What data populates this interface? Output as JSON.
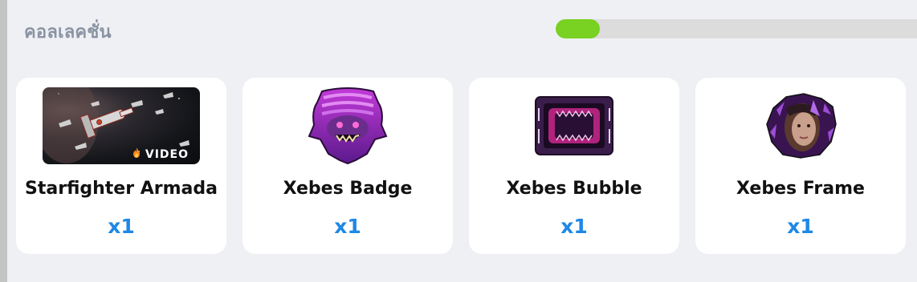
{
  "section": {
    "title": "คอลเลคชั่น"
  },
  "progress": {
    "fraction": 0.12,
    "fill_color": "#79d121",
    "track_color": "#dcdcdc"
  },
  "items": [
    {
      "name": "Starfighter Armada",
      "quantity": "x1",
      "badge": "VIDEO",
      "thumb_icon": "starfighter-video-thumbnail"
    },
    {
      "name": "Xebes Badge",
      "quantity": "x1",
      "thumb_icon": "xebes-badge-image"
    },
    {
      "name": "Xebes Bubble",
      "quantity": "x1",
      "thumb_icon": "xebes-bubble-image"
    },
    {
      "name": "Xebes Frame",
      "quantity": "x1",
      "thumb_icon": "xebes-frame-image"
    }
  ],
  "colors": {
    "quantity": "#1e88e5",
    "background": "#eef0f3",
    "title": "#8a93a3"
  }
}
